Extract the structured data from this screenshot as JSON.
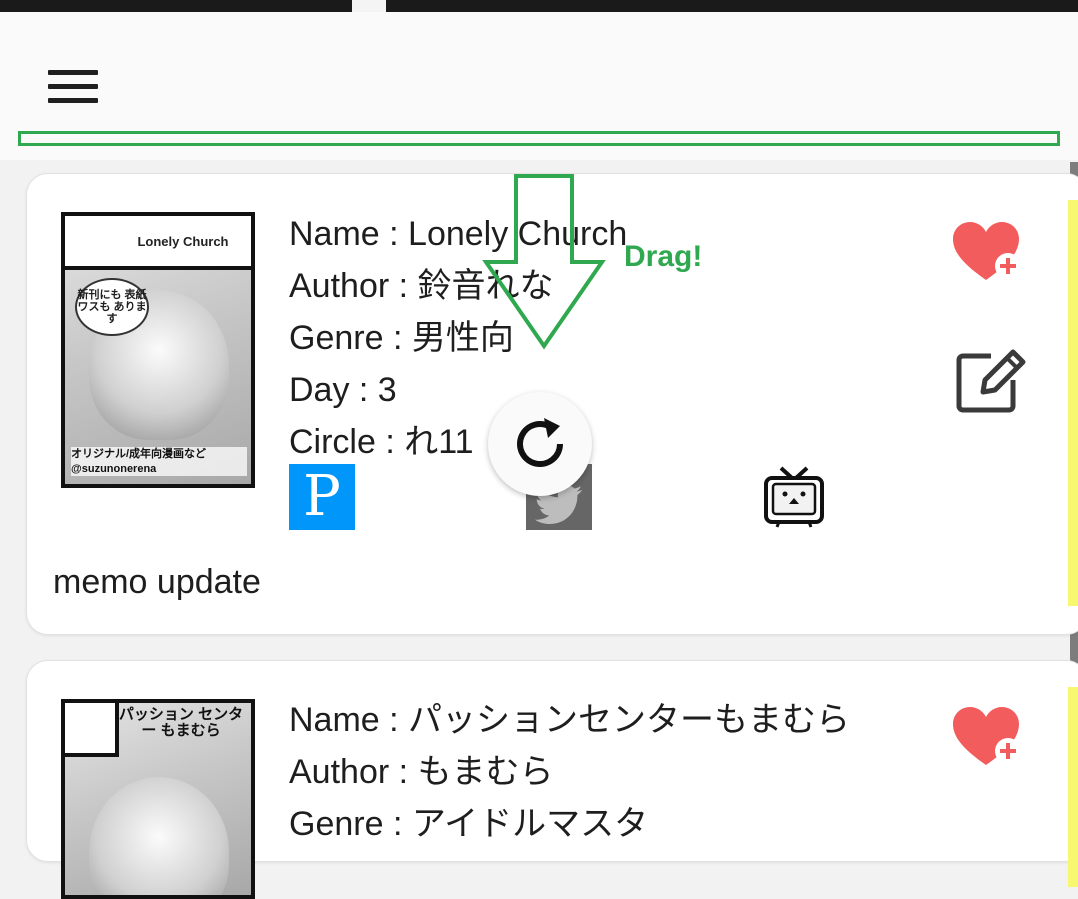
{
  "app_bar": {
    "menu_icon": "hamburger-menu-icon"
  },
  "annotation": {
    "drag_label": "Drag!",
    "accent_color": "#2fa84f"
  },
  "refresh": {
    "icon": "refresh-icon"
  },
  "cards": [
    {
      "name_line": "Name : Lonely Church",
      "author_line": "Author : 鈴音れな",
      "genre_line": "Genre : 男性向",
      "day_line": "Day : 3",
      "circle_line": "Circle : れ11",
      "cover": {
        "banner": "Lonely Church",
        "bubble": "新刊にも 表紙ワスも あります",
        "caption": "オリジナル/成年向漫画など @suzunonerena"
      },
      "links": [
        "pixiv-icon",
        "twitter-icon",
        "niconico-icon"
      ],
      "pixiv_glyph": "P",
      "memo": "memo update",
      "favorite_icon": "heart-plus-icon",
      "edit_icon": "edit-icon",
      "marker_color": "#f8f870"
    },
    {
      "name_line": "Name : パッションセンターもまむら",
      "author_line": "Author : もまむら",
      "genre_line": "Genre : アイドルマスタ",
      "cover": {
        "title": "パッション センター もまむら"
      },
      "favorite_icon": "heart-plus-icon",
      "marker_color": "#f8f870"
    }
  ]
}
